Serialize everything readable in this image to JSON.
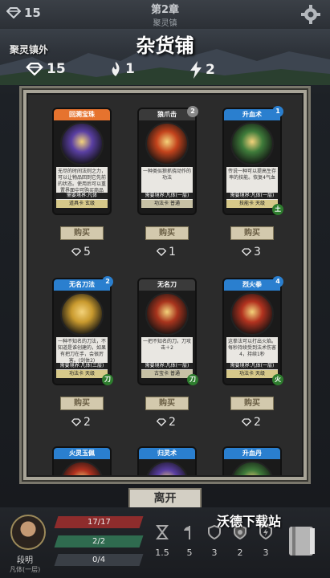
{
  "topbar": {
    "gems": "15",
    "chapter": "第2章",
    "location": "聚灵镇"
  },
  "scene": {
    "area_label": "聚灵镇外",
    "title": "杂货铺"
  },
  "resources": {
    "gems": "15",
    "souls": "1",
    "energy": "2"
  },
  "cards": [
    {
      "title": "回溯宝珠",
      "badge": "",
      "desc": "无尽的时间法则之力，可以让物品回到它先前的状态。使用后可以重置界面中可购买商品",
      "req": "需要境界:凡体",
      "tag": "道具卡 玄级",
      "head_color": "#e6732e",
      "art": "#5a3fa3",
      "buy": "购买",
      "price": "5",
      "corner": ""
    },
    {
      "title": "狼爪击",
      "badge": "2",
      "desc": "一种类似狼抓挠动作的功法",
      "req": "需要境界:凡体(一层)",
      "tag": "功法卡 普通",
      "head_color": "#3a3a3a",
      "art": "#c3431c",
      "buy": "购买",
      "price": "1",
      "corner": ""
    },
    {
      "title": "升血术",
      "badge": "1",
      "desc": "传说一种可以提高生存率的技能。恢复4气血",
      "req": "需要境界:凡体(一层)",
      "tag": "技能卡 天级",
      "head_color": "#2a7fcf",
      "art": "#3e7b3a",
      "buy": "购买",
      "price": "3",
      "corner": "土"
    },
    {
      "title": "无名刀法",
      "badge": "2",
      "desc": "一种不知名的刀法，不知道是谁创建的，如果有把刀在手，会很厉害。(剑体2)",
      "req": "需要境界:凡体(三层)",
      "tag": "功法卡 天级",
      "head_color": "#2a7fcf",
      "art": "#c99a2e",
      "buy": "购买",
      "price": "2",
      "corner": "刀"
    },
    {
      "title": "无名刀",
      "badge": "",
      "desc": "一把不知名的刀。刀攻击＋2",
      "req": "需要境界:凡体(一层)",
      "tag": "古宝卡 普通",
      "head_color": "#3a3a3a",
      "art": "#a8341d",
      "buy": "购买",
      "price": "2",
      "corner": "刀"
    },
    {
      "title": "烈火拳",
      "badge": "4",
      "desc": "这拳法可以打出火焰。每秒持续受到法术伤害4，持续1秒",
      "req": "需要境界:凡体(一层)",
      "tag": "功法卡 天级",
      "head_color": "#2a7fcf",
      "art": "#b2321f",
      "buy": "购买",
      "price": "2",
      "corner": "火"
    },
    {
      "title": "火灵玉佩",
      "badge": "",
      "desc": "",
      "req": "",
      "tag": "",
      "head_color": "#2a7fcf",
      "art": "#b2321f",
      "buy": "",
      "price": "",
      "corner": ""
    },
    {
      "title": "归灵术",
      "badge": "",
      "desc": "",
      "req": "",
      "tag": "",
      "head_color": "#2a7fcf",
      "art": "#5a3fa3",
      "buy": "",
      "price": "",
      "corner": ""
    },
    {
      "title": "升血丹",
      "badge": "",
      "desc": "",
      "req": "",
      "tag": "",
      "head_color": "#2a7fcf",
      "art": "#3e7b3a",
      "buy": "",
      "price": "",
      "corner": ""
    }
  ],
  "leave_label": "离开",
  "player": {
    "name": "段明",
    "rank": "凡体(一层)",
    "hp": "17/17",
    "mp": "2/2",
    "exp": "0/4"
  },
  "stats": [
    "1.5",
    "5",
    "3",
    "2",
    "3"
  ],
  "watermark": "沃德下载站",
  "colors": {
    "hp": "#8e2c2c",
    "mp": "#2f6b4f",
    "exp": "#3a3f46",
    "price_gem": "#e8e8e8"
  }
}
